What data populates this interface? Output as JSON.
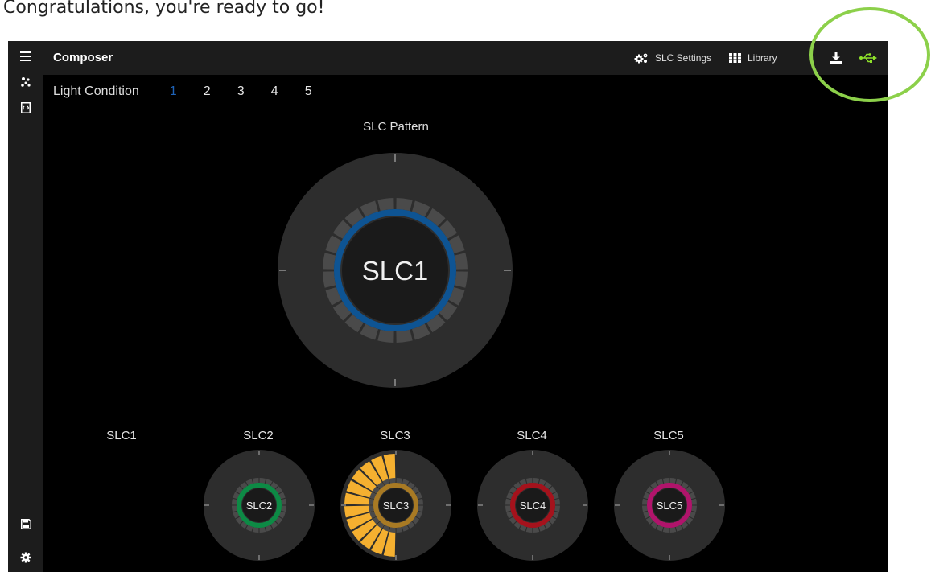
{
  "caption": "Congratulations, you're ready to go!",
  "sidebar": {
    "items": [
      {
        "icon": "menu-icon"
      },
      {
        "icon": "spark-icon"
      },
      {
        "icon": "code-file-icon"
      },
      {
        "icon": "save-icon"
      },
      {
        "icon": "gear-icon"
      }
    ]
  },
  "topbar": {
    "title": "Composer",
    "slc_settings_label": "SLC Settings",
    "library_label": "Library",
    "download_icon": "download-icon",
    "usb_icon": "usb-icon"
  },
  "light_condition": {
    "label": "Light Condition",
    "options": [
      "1",
      "2",
      "3",
      "4",
      "5"
    ],
    "selected": "1"
  },
  "pattern": {
    "title": "SLC Pattern",
    "center_label": "SLC1",
    "color": "#0e5493"
  },
  "slcs": [
    {
      "label": "SLC1",
      "ring_label": ""
    },
    {
      "label": "SLC2",
      "ring_label": "SLC2",
      "color": "#0d8a45"
    },
    {
      "label": "SLC3",
      "ring_label": "SLC3",
      "color": "#a87a24",
      "fan_color": "#f5b030"
    },
    {
      "label": "SLC4",
      "ring_label": "SLC4",
      "color": "#a5121c"
    },
    {
      "label": "SLC5",
      "ring_label": "SLC5",
      "color": "#b0146b"
    }
  ],
  "colors": {
    "accent_blue": "#1e63b8",
    "usb_green": "#8ee02a",
    "highlight_green": "#8cd04a"
  }
}
